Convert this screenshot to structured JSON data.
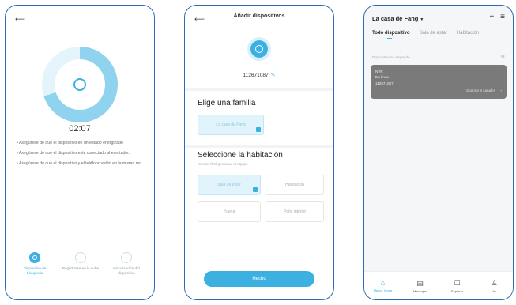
{
  "screen1": {
    "timer": "02:07",
    "tips": [
      "• Asegúrese de que el dispositivo en un estado energizado",
      "• Asegúrese de que el dispositivo esté conectado al enrutador.",
      "• Asegúrese de que el dispositivo y el teléfono estén en la misma red."
    ],
    "steps": [
      {
        "label": "Dispositivo de búsqueda"
      },
      {
        "label": "Registrarse en la nube"
      },
      {
        "label": "Inicialización del dispositivo"
      }
    ]
  },
  "screen2": {
    "title": "Añadir dispositivos",
    "device_id": "112671087",
    "family_heading": "Elige una familia",
    "family_chip": "La casa de Fang",
    "room_heading": "Seleccione la habitación",
    "room_sub": "Es más fácil gestionar el equipo",
    "rooms": [
      "Sala de estar",
      "Habitación",
      "Puerta",
      "Patio interior"
    ],
    "done_button": "Hecho"
  },
  "screen3": {
    "home_title": "La casa de Fang",
    "tabs": [
      "Todo dispositivo",
      "Sala de estar",
      "Habitación"
    ],
    "unassigned_label": "Dispositivo no asignado",
    "card": {
      "name": "NVR",
      "status": "En línea",
      "id": "112671087",
      "support": "Soporte 8 canales"
    },
    "tabbar": [
      {
        "label": "Mapa - hogar",
        "icon": "home-icon"
      },
      {
        "label": "Mensajes",
        "icon": "message-icon"
      },
      {
        "label": "Explorar",
        "icon": "explore-icon"
      },
      {
        "label": "Yo",
        "icon": "user-icon"
      }
    ]
  }
}
